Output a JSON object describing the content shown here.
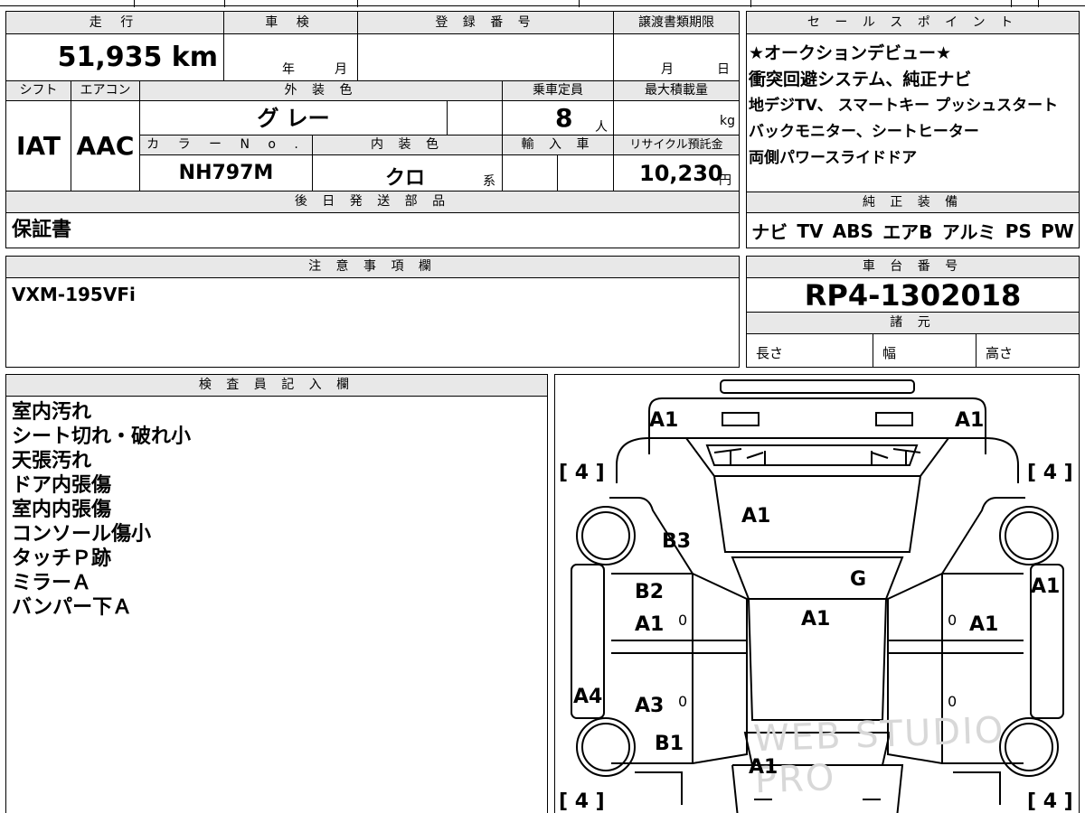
{
  "headers": {
    "mileage": "走 行",
    "inspection": "車 検",
    "registration": "登 録 番 号",
    "transfer": "譲渡書類期限",
    "shift": "シフト",
    "aircon": "エアコン",
    "ext_color": "外 装 色",
    "capacity": "乗車定員",
    "max_load": "最大積載量",
    "color_no": "カ ラ ー N o .",
    "int_color": "内 装 色",
    "import": "輸 入 車",
    "recycle": "リサイクル預託金",
    "later_parts": "後 日 発 送 部 品",
    "notes": "注 意 事 項 欄",
    "sales_points": "セ ー ル ス ポ イ ン ト",
    "standard_equipment": "純 正 装 備",
    "chassis_no": "車 台 番 号",
    "specs": "諸 元",
    "inspector": "検 査 員 記 入 欄"
  },
  "values": {
    "mileage": "51,935 km",
    "inspection_year": "年",
    "inspection_month": "月",
    "transfer_month": "月",
    "transfer_day": "日",
    "shift": "IAT",
    "aircon": "AAC",
    "ext_color": "グ レー",
    "capacity": "8",
    "capacity_unit": "人",
    "max_load_unit": "kg",
    "color_no": "NH797M",
    "int_color": "クロ",
    "int_color_suffix": "系",
    "recycle": "10,230",
    "recycle_unit": "円",
    "later_parts": "保証書",
    "notes": "VXM-195VFi",
    "chassis_no": "RP4-1302018",
    "length_label": "長さ",
    "width_label": "幅",
    "height_label": "高さ"
  },
  "sales_points": [
    "★オークションデビュー★",
    "衝突回避システム、純正ナビ",
    "地デジTV、 スマートキー プッシュスタート",
    "バックモニター、シートヒーター",
    "両側パワースライドドア"
  ],
  "equipment": [
    "ナビ",
    "TV",
    "ABS",
    "エアB",
    "アルミ",
    "PS",
    "PW"
  ],
  "inspector_notes": [
    "室内汚れ",
    "シート切れ・破れ小",
    "天張汚れ",
    "ドア内張傷",
    "室内内張傷",
    "コンソール傷小",
    "タッチＰ跡",
    "ミラーＡ",
    "バンパー下Ａ"
  ],
  "diagram": {
    "marks": {
      "front_left": "A1",
      "front_right": "A1",
      "hood": "A1",
      "left_fender": "B3",
      "windshield_right": "G",
      "left_front_door_1": "B2",
      "left_front_door_2": "A1",
      "roof": "A1",
      "right_front_door": "A1",
      "right_mirror_side": "A1",
      "left_sill": "A4",
      "left_rear_door": "A3",
      "left_rear_fender": "B1",
      "trunk": "A1",
      "zero_1": "0",
      "zero_2": "0",
      "zero_3": "0",
      "zero_4": "0"
    },
    "tire_tl": "[ 4 ]",
    "tire_tr": "[ 4 ]",
    "tire_bl": "[ 4 ]",
    "tire_br": "[ 4 ]",
    "watermark": "WEB STUDIO PRO"
  }
}
